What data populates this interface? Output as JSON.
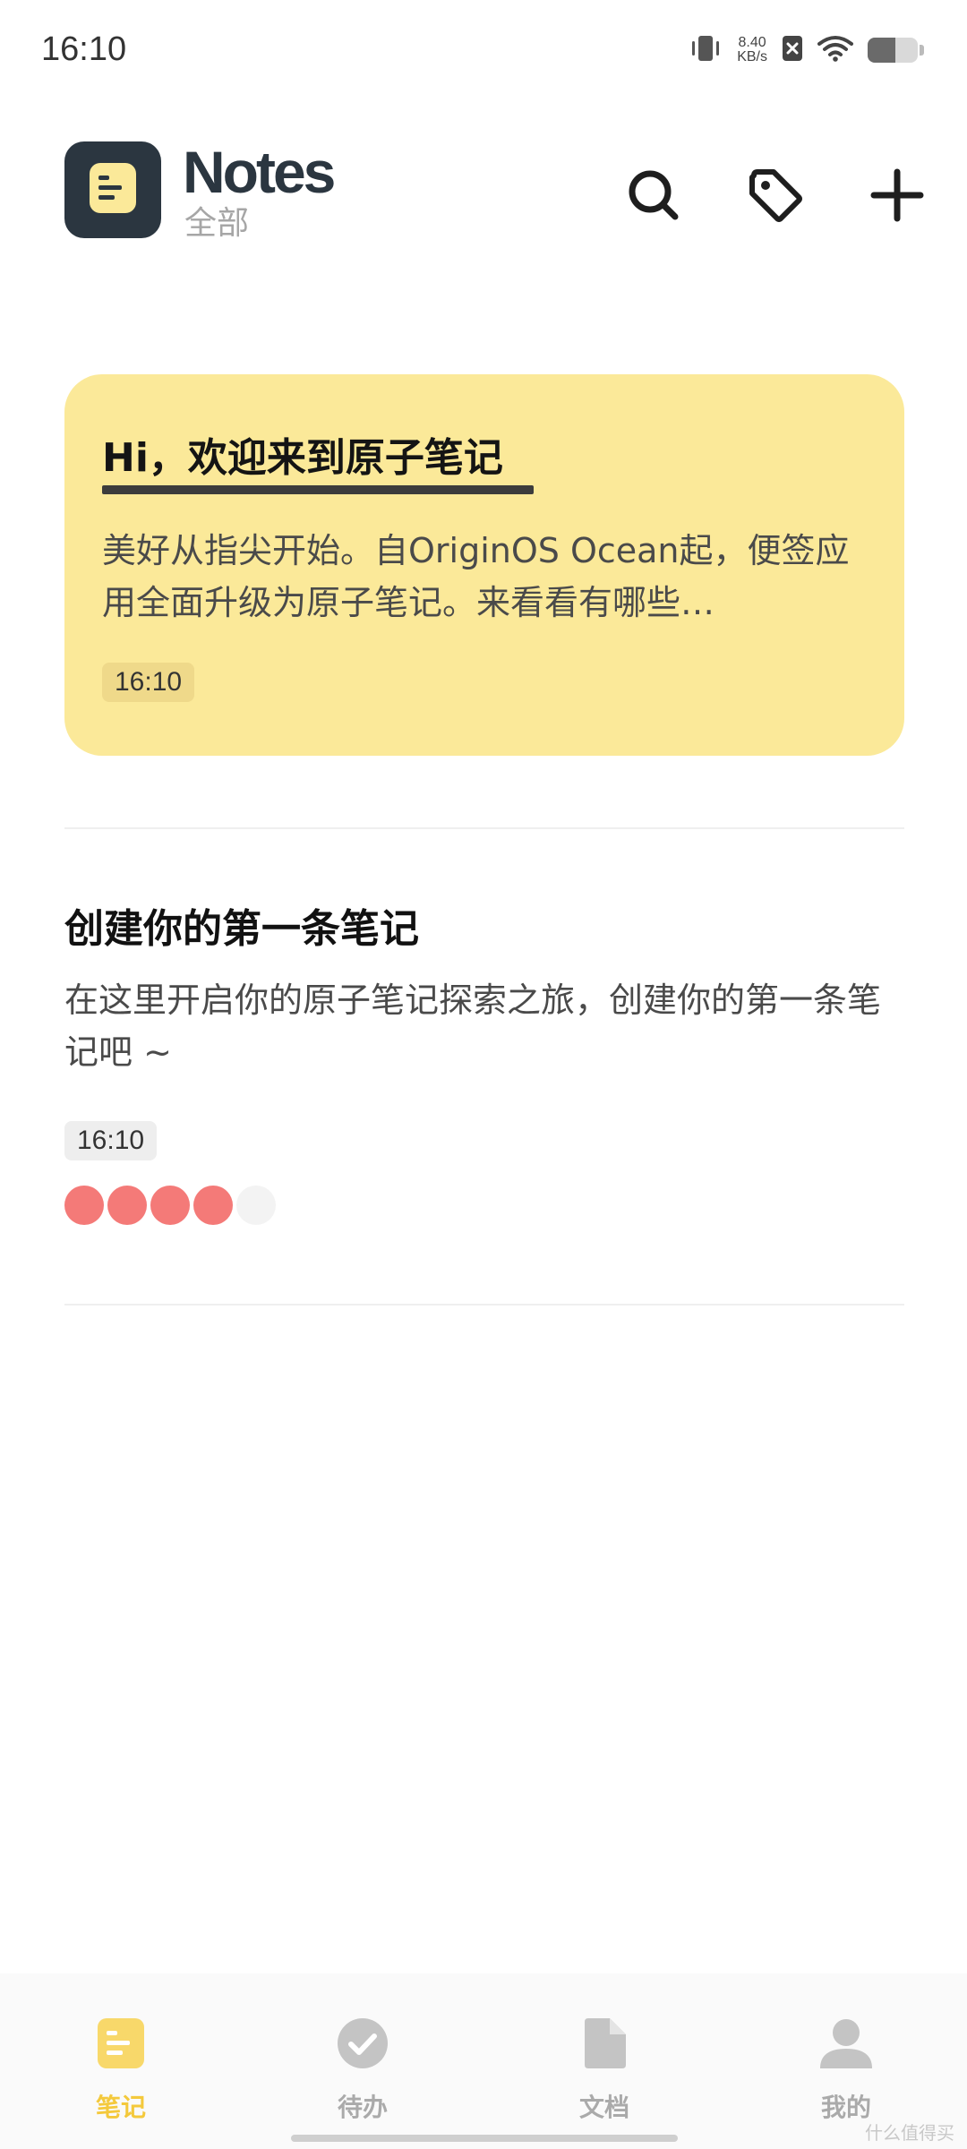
{
  "status_bar": {
    "time": "16:10",
    "net_speed_value": "8.40",
    "net_speed_unit": "KB/s",
    "battery_level": 0.55,
    "icons": [
      "vibrate-icon",
      "sim-disabled-icon",
      "wifi-icon",
      "battery-icon"
    ]
  },
  "header": {
    "title": "Notes",
    "subtitle": "全部",
    "actions": [
      "search-icon",
      "tag-icon",
      "add-icon"
    ]
  },
  "welcome_card": {
    "title": "Hi，欢迎来到原子笔记",
    "body": "美好从指尖开始。自OriginOS Ocean起，便签应用全面升级为原子笔记。来看看有哪些…",
    "time": "16:10",
    "color": "#fbe999"
  },
  "note": {
    "title": "创建你的第一条笔记",
    "body": "在这里开启你的原子笔记探索之旅，创建你的第一条笔记吧 ~",
    "time": "16:10",
    "dots": [
      "#f47a78",
      "#f47a78",
      "#f47a78",
      "#f47a78",
      "#f3f3f3"
    ]
  },
  "bottom_nav": {
    "items": [
      {
        "label": "笔记",
        "icon": "note-icon",
        "active": true
      },
      {
        "label": "待办",
        "icon": "todo-check-icon",
        "active": false
      },
      {
        "label": "文档",
        "icon": "document-icon",
        "active": false
      },
      {
        "label": "我的",
        "icon": "profile-icon",
        "active": false
      }
    ]
  },
  "watermark": "什么值得买",
  "colors": {
    "accent": "#f4c93c",
    "logo_bg": "#2b3640",
    "card_yellow": "#fbe999"
  }
}
